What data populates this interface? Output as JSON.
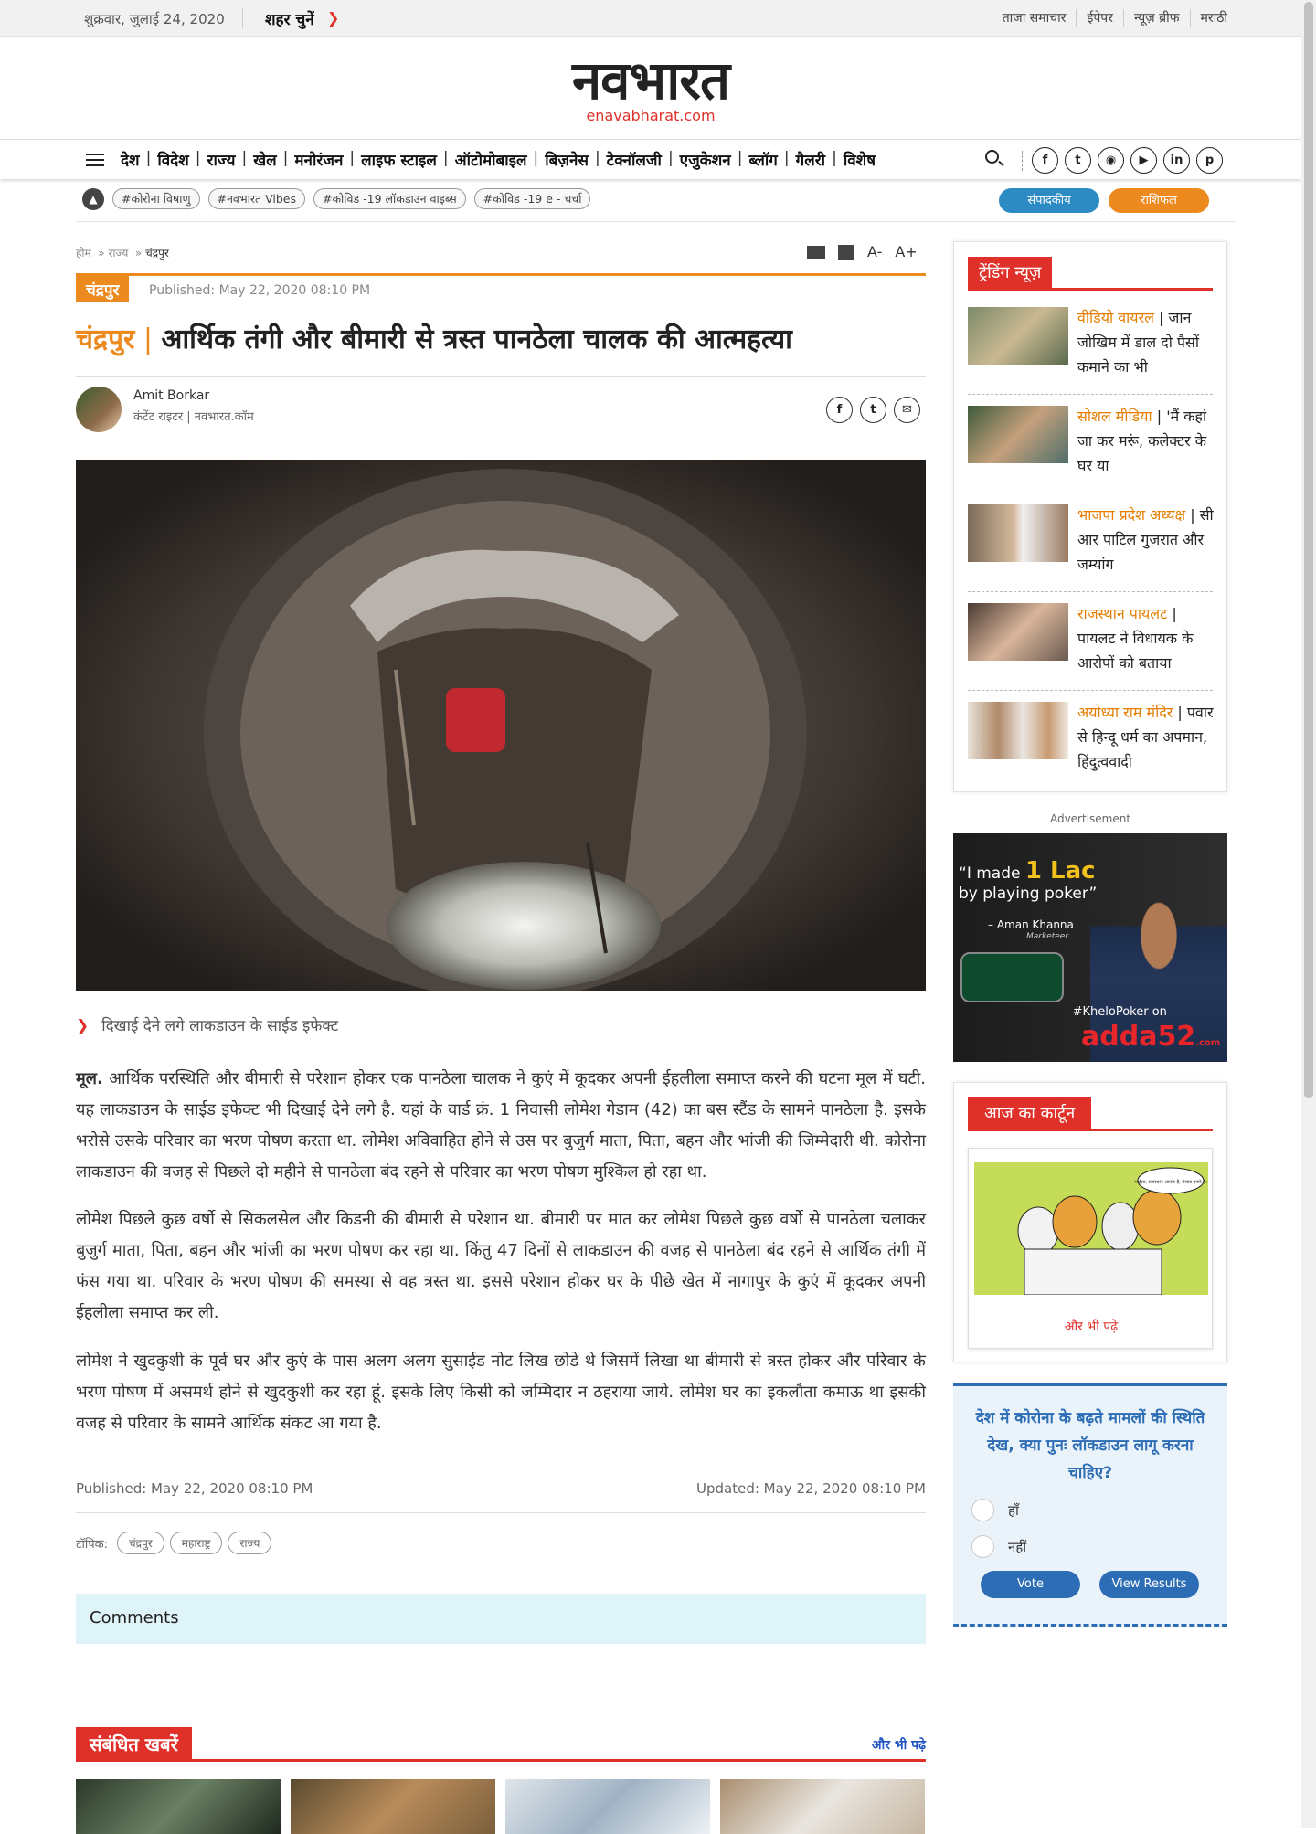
{
  "topbar": {
    "date": "शुक्रवार, जुलाई 24, 2020",
    "city_select": "शहर चुनें",
    "links": [
      "ताजा समाचार",
      "ईपेपर",
      "न्यूज़ ब्रीफ",
      "मराठी"
    ]
  },
  "logo": {
    "name": "नवभारत",
    "site": "enavabharat.com"
  },
  "nav": {
    "items": [
      "देश",
      "विदेश",
      "राज्य",
      "खेल",
      "मनोरंजन",
      "लाइफ स्टाइल",
      "ऑटोमोबाइल",
      "बिज़नेस",
      "टेक्नॉलजी",
      "एजुकेशन",
      "ब्लॉग",
      "गैलरी",
      "विशेष"
    ],
    "social_icons": [
      "facebook-icon",
      "twitter-icon",
      "instagram-icon",
      "youtube-icon",
      "linkedin-icon",
      "pinterest-icon"
    ]
  },
  "tagbar": {
    "tags": [
      "#कोरोना विषाणु",
      "#नवभारत Vibes",
      "#कोविड -19 लॉकडाउन वाइब्स",
      "#कोविड -19 e - चर्चा"
    ],
    "btn_sampadkiya": "संपादकीय",
    "btn_rashifal": "राशिफल"
  },
  "article": {
    "breadcrumb": [
      "होम",
      "राज्य",
      "चंद्रपुर"
    ],
    "category": "चंद्रपुर",
    "published_top": "Published: May 22, 2020 08:10 PM",
    "title_category": "चंद्रपुर",
    "title": "आर्थिक तंगी और बीमारी से त्रस्त पानठेला चालक की आत्महत्या",
    "author_name": "Amit Borkar",
    "author_role": "कंटेंट राइटर | नवभारत.कॉम",
    "caption": "दिखाई देने लगे लाकडाउन के साईड इफेक्ट",
    "para1_lead": "मूल.",
    "para1": " आर्थिक परस्थिति और बीमारी से परेशान होकर एक पानठेला चालक ने कुएं में कूदकर अपनी ईहलीला समाप्त करने की घटना मूल में घटी. यह लाकडाउन के साईड इफेक्ट भी दिखाई देने लगे है. यहां के वार्ड क्रं. 1 निवासी लोमेश गेडाम (42) का बस स्टैंड के सामने पानठेला है. इसके भरोसे उसके परिवार का भरण पोषण करता था. लोमेश अविवाहित होने से उस पर बुजुर्ग माता, पिता, बहन और भांजी की जिम्मेदारी थी. कोरोना लाकडाउन की वजह से पिछले दो महीने से पानठेला बंद रहने से परिवार का भरण पोषण मुश्किल हो रहा था.",
    "para2": "लोमेश पिछले कुछ वर्षो से सिकलसेल और किडनी की बीमारी से परेशान था. बीमारी पर मात कर लोमेश पिछले कुछ वर्षो से पानठेला चलाकर बुजुर्ग माता, पिता, बहन और भांजी का भरण पोषण कर रहा था. किंतु 47 दिनों से लाकडाउन की वजह से पानठेला बंद रहने से आर्थिक तंगी में फंस गया था. परिवार के भरण पोषण की समस्या से वह त्रस्त था. इससे परेशान होकर घर के पीछे खेत में नागापुर के कुएं में कूदकर अपनी ईहलीला समाप्त कर ली.",
    "para3": "लोमेश ने खुदकुशी के पूर्व घर और कुएं के पास अलग अलग सुसाईड नोट लिख छोडे थे जिसमें लिखा था बीमारी से त्रस्त होकर और परिवार के भरण पोषण में असमर्थ होने से खुदकुशी कर रहा हूं. इसके लिए किसी को जम्मिदार न ठहराया जाये. लोमेश घर का इकलौता कमाऊ था इसकी वजह से परिवार के सामने आर्थिक संकट आ गया है.",
    "published_bottom": "Published: May 22, 2020 08:10 PM",
    "updated_bottom": "Updated: May 22, 2020 08:10 PM",
    "topics_label": "टॉपिक:",
    "topics": [
      "चंद्रपुर",
      "महाराष्ट्र",
      "राज्य"
    ],
    "comments_label": "Comments"
  },
  "related": {
    "title": "संबंधित खबरें",
    "more": "और भी पढ़े"
  },
  "sidebar": {
    "trending_title": "ट्रेंडिंग न्यूज़",
    "trending": [
      {
        "kicker": "वीडियो वायरल",
        "text": "जान जोखिम में डाल दो पैसों कमाने का भी"
      },
      {
        "kicker": "सोशल मीडिया",
        "text": "'मैं कहां जा कर मरूं, कलेक्टर के घर या"
      },
      {
        "kicker": "भाजपा प्रदेश अध्यक्ष",
        "text": "सी आर पाटिल गुजरात और जम्यांग"
      },
      {
        "kicker": "राजस्थान पायलट",
        "text": "पायलट ने विधायक के आरोपों को बताया"
      },
      {
        "kicker": "अयोध्या राम मंदिर",
        "text": "पवार से हिन्दू धर्म का अपमान, हिंदुत्ववादी"
      }
    ],
    "ad_label": "Advertisement",
    "ad": {
      "quote_a": "I made",
      "amount": "1 Lac",
      "quote_b": "by playing poker",
      "person": "– Aman Khanna",
      "role": "Marketeer",
      "hashtag": "– #KheloPoker on –",
      "brand": "adda52",
      "brand_suffix": ".com"
    },
    "cartoon_title": "आज का कार्टून",
    "cartoon_bubble": "भाईसा, राजस्थान आपके हैं, पंजाब हमारे हैं।",
    "cartoon_more": "और भी पढ़े",
    "poll_question": "देश में कोरोना के बढ़ते मामलों की स्थिति देख, क्या पुनः लॉकडाउन लागू करना चाहिए?",
    "poll_options": [
      "हाँ",
      "नहीं"
    ],
    "poll_vote": "Vote",
    "poll_results": "View Results"
  }
}
